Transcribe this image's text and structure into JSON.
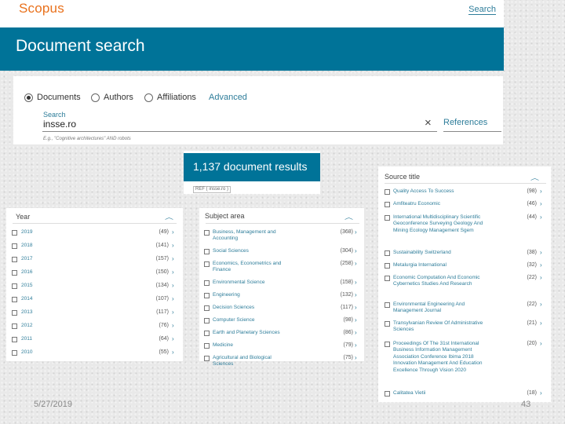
{
  "header": {
    "logo": "Scopus",
    "search_link": "Search",
    "banner_title": "Document search"
  },
  "search": {
    "radios": [
      {
        "label": "Documents",
        "selected": true
      },
      {
        "label": "Authors",
        "selected": false
      },
      {
        "label": "Affiliations",
        "selected": false
      }
    ],
    "advanced": "Advanced",
    "field_label": "Search",
    "value": "insse.ro",
    "clear_icon": "×",
    "references": "References",
    "example": "E.g., \"Cognitive architectures\" AND robots"
  },
  "results": {
    "title": "1,137 document results",
    "query": "REF ( insse.ro )"
  },
  "year_filter": {
    "title": "Year",
    "items": [
      {
        "label": "2019",
        "count": "(49)"
      },
      {
        "label": "2018",
        "count": "(141)"
      },
      {
        "label": "2017",
        "count": "(157)"
      },
      {
        "label": "2016",
        "count": "(150)"
      },
      {
        "label": "2015",
        "count": "(134)"
      },
      {
        "label": "2014",
        "count": "(107)"
      },
      {
        "label": "2013",
        "count": "(117)"
      },
      {
        "label": "2012",
        "count": "(76)"
      },
      {
        "label": "2011",
        "count": "(64)"
      },
      {
        "label": "2010",
        "count": "(55)"
      }
    ]
  },
  "subject_filter": {
    "title": "Subject area",
    "items": [
      {
        "label": "Business, Management and Accounting",
        "count": "(368)"
      },
      {
        "label": "Social Sciences",
        "count": "(304)"
      },
      {
        "label": "Economics, Econometrics and Finance",
        "count": "(258)"
      },
      {
        "label": "Environmental Science",
        "count": "(158)"
      },
      {
        "label": "Engineering",
        "count": "(132)"
      },
      {
        "label": "Decision Sciences",
        "count": "(117)"
      },
      {
        "label": "Computer Science",
        "count": "(98)"
      },
      {
        "label": "Earth and Planetary Sciences",
        "count": "(86)"
      },
      {
        "label": "Medicine",
        "count": "(79)"
      },
      {
        "label": "Agricultural and Biological Sciences",
        "count": "(75)"
      }
    ]
  },
  "source_filter": {
    "title": "Source title",
    "items": [
      {
        "label": "Quality Access To Success",
        "count": "(98)"
      },
      {
        "label": "Amfiteatru Economic",
        "count": "(46)"
      },
      {
        "label": "International Multidisciplinary Scientific Geoconference Surveying Geology And Mining Ecology Management Sgem",
        "count": "(44)"
      },
      {
        "label": "Sustainability Switzerland",
        "count": "(38)"
      },
      {
        "label": "Metalurgia International",
        "count": "(32)"
      },
      {
        "label": "Economic Computation And Economic Cybernetics Studies And Research",
        "count": "(22)"
      },
      {
        "label": "Environmental Engineering And Management Journal",
        "count": "(22)"
      },
      {
        "label": "Transylvanian Review Of Administrative Sciences",
        "count": "(21)"
      },
      {
        "label": "Proceedings Of The 31st International Business Information Management Association Conference Ibima 2018 Innovation Management And Education Excellence Through Vision 2020",
        "count": "(20)"
      },
      {
        "label": "Calitatea Vietii",
        "count": "(18)"
      }
    ]
  },
  "footer": {
    "date": "5/27/2019",
    "page": "43"
  }
}
